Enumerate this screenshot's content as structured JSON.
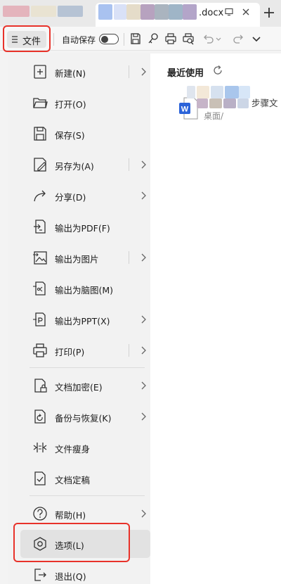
{
  "titlebar": {
    "tab_title_fragment": ".docx"
  },
  "toolbar": {
    "file_label": "文件",
    "autosave_label": "自动保存",
    "autosave_on": false
  },
  "menu": {
    "items": [
      {
        "label": "新建(N)",
        "icon": "new-icon",
        "submenu": true
      },
      {
        "label": "打开(O)",
        "icon": "folder-open-icon",
        "submenu": false
      },
      {
        "label": "保存(S)",
        "icon": "save-icon",
        "submenu": false
      },
      {
        "label": "另存为(A)",
        "icon": "save-as-icon",
        "submenu": true
      },
      {
        "label": "分享(D)",
        "icon": "share-icon",
        "submenu": true
      },
      {
        "label": "输出为PDF(F)",
        "icon": "export-pdf-icon",
        "submenu": false
      },
      {
        "label": "输出为图片",
        "icon": "export-image-icon",
        "submenu": true
      },
      {
        "label": "输出为脑图(M)",
        "icon": "export-mindmap-icon",
        "submenu": false
      },
      {
        "label": "输出为PPT(X)",
        "icon": "export-ppt-icon",
        "submenu": true
      },
      {
        "label": "打印(P)",
        "icon": "print-icon",
        "submenu": true
      },
      {
        "label": "文档加密(E)",
        "icon": "encrypt-icon",
        "submenu": true
      },
      {
        "label": "备份与恢复(K)",
        "icon": "backup-icon",
        "submenu": true
      },
      {
        "label": "文件瘦身",
        "icon": "slim-icon",
        "submenu": false
      },
      {
        "label": "文档定稿",
        "icon": "finalize-icon",
        "submenu": false
      },
      {
        "label": "帮助(H)",
        "icon": "help-icon",
        "submenu": true
      },
      {
        "label": "选项(L)",
        "icon": "options-icon",
        "submenu": false,
        "selected": true
      },
      {
        "label": "退出(Q)",
        "icon": "exit-icon",
        "submenu": false
      }
    ]
  },
  "recent": {
    "title": "最近使用",
    "file_name_fragment": "步骤文",
    "file_path_fragment": "桌面/"
  },
  "colors": {
    "highlight_red": "#e8322a",
    "word_blue": "#2b63d9"
  }
}
